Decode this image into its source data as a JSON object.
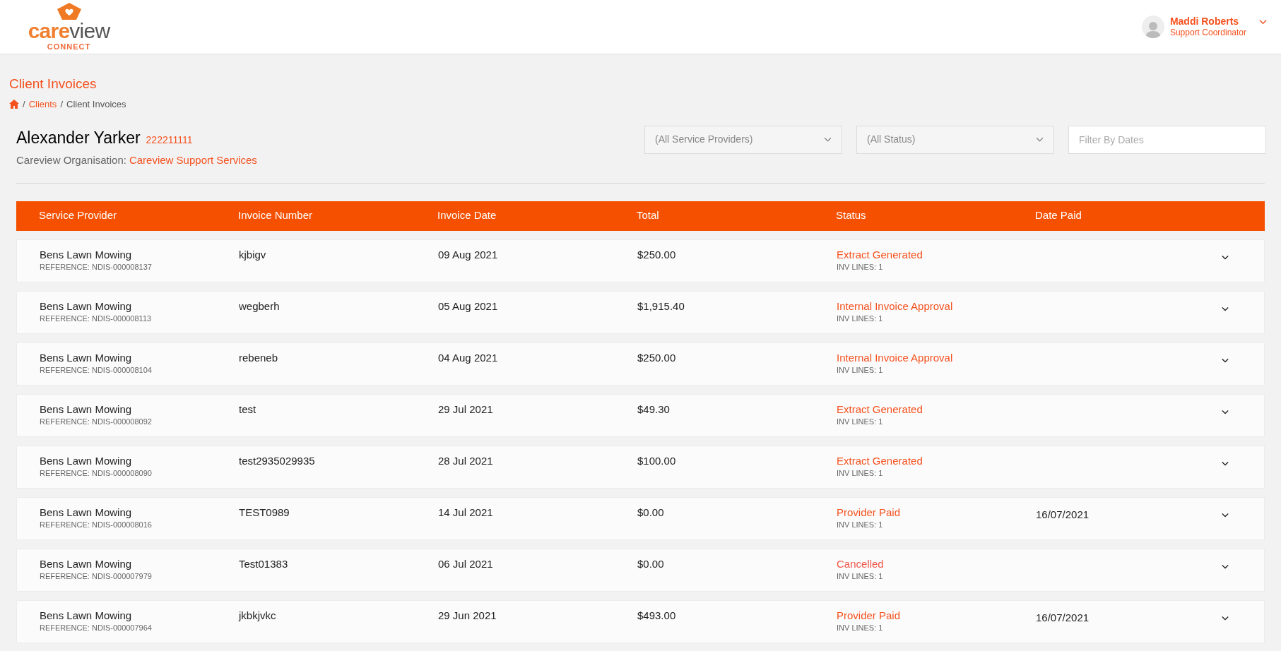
{
  "logo": {
    "primary": "care",
    "secondary": "view",
    "tagline": "CONNECT"
  },
  "user": {
    "name": "Maddi Roberts",
    "role": "Support Coordinator"
  },
  "page_title": "Client Invoices",
  "breadcrumb_separator": "/",
  "breadcrumb": [
    {
      "label": "Clients",
      "link": true
    },
    {
      "label": "Client Invoices",
      "link": false
    }
  ],
  "client": {
    "name": "Alexander Yarker",
    "number": "222211111",
    "org_label": "Careview Organisation:",
    "org_name": "Careview Support Services"
  },
  "filters": {
    "provider": "(All Service Providers)",
    "status": "(All Status)",
    "dates_placeholder": "Filter By Dates"
  },
  "table": {
    "columns": [
      "Service Provider",
      "Invoice Number",
      "Invoice Date",
      "Total",
      "Status",
      "Date Paid"
    ],
    "rows": [
      {
        "provider": "Bens Lawn Mowing",
        "reference": "REFERENCE: NDIS-000008137",
        "invoice": "kjbigv",
        "date": "09 Aug 2021",
        "total": "$250.00",
        "status": "Extract Generated",
        "color": "#f4511e",
        "lines": "INV LINES: 1",
        "paid": ""
      },
      {
        "provider": "Bens Lawn Mowing",
        "reference": "REFERENCE: NDIS-000008113",
        "invoice": "wegberh",
        "date": "05 Aug 2021",
        "total": "$1,915.40",
        "status": "Internal Invoice Approval",
        "color": "#f4511e",
        "lines": "INV LINES: 1",
        "paid": ""
      },
      {
        "provider": "Bens Lawn Mowing",
        "reference": "REFERENCE: NDIS-000008104",
        "invoice": "rebeneb",
        "date": "04 Aug 2021",
        "total": "$250.00",
        "status": "Internal Invoice Approval",
        "color": "#f4511e",
        "lines": "INV LINES: 1",
        "paid": ""
      },
      {
        "provider": "Bens Lawn Mowing",
        "reference": "REFERENCE: NDIS-000008092",
        "invoice": "test",
        "date": "29 Jul 2021",
        "total": "$49.30",
        "status": "Extract Generated",
        "color": "#f4511e",
        "lines": "INV LINES: 1",
        "paid": ""
      },
      {
        "provider": "Bens Lawn Mowing",
        "reference": "REFERENCE: NDIS-000008090",
        "invoice": "test2935029935",
        "date": "28 Jul 2021",
        "total": "$100.00",
        "status": "Extract Generated",
        "color": "#f4511e",
        "lines": "INV LINES: 1",
        "paid": ""
      },
      {
        "provider": "Bens Lawn Mowing",
        "reference": "REFERENCE: NDIS-000008016",
        "invoice": "TEST0989",
        "date": "14 Jul 2021",
        "total": "$0.00",
        "status": "Provider Paid",
        "color": "#f4511e",
        "lines": "INV LINES: 1",
        "paid": "16/07/2021"
      },
      {
        "provider": "Bens Lawn Mowing",
        "reference": "REFERENCE: NDIS-000007979",
        "invoice": "Test01383",
        "date": "06 Jul 2021",
        "total": "$0.00",
        "status": "Cancelled",
        "color": "#f0564a",
        "lines": "INV LINES: 1",
        "paid": ""
      },
      {
        "provider": "Bens Lawn Mowing",
        "reference": "REFERENCE: NDIS-000007964",
        "invoice": "jkbkjvkc",
        "date": "29 Jun 2021",
        "total": "$493.00",
        "status": "Provider Paid",
        "color": "#f4511e",
        "lines": "INV LINES: 1",
        "paid": "16/07/2021"
      }
    ]
  }
}
